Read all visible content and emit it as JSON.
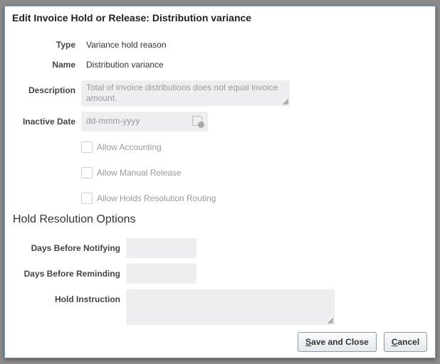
{
  "dialog": {
    "title": "Edit Invoice Hold or Release: Distribution variance"
  },
  "form": {
    "type_label": "Type",
    "type_value": "Variance hold reason",
    "name_label": "Name",
    "name_value": "Distribution variance",
    "description_label": "Description",
    "description_value": "Total of invoice distributions does not equal invoice amount.",
    "inactive_date_label": "Inactive Date",
    "inactive_date_placeholder": "dd-mmm-yyyy",
    "allow_accounting": "Allow Accounting",
    "allow_manual_release": "Allow Manual Release",
    "allow_routing": "Allow Holds Resolution Routing"
  },
  "resolution": {
    "heading": "Hold Resolution Options",
    "days_notifying_label": "Days Before Notifying",
    "days_reminding_label": "Days Before Reminding",
    "instruction_label": "Hold Instruction"
  },
  "buttons": {
    "save_first": "S",
    "save_rest": "ave and Close",
    "cancel_first": "C",
    "cancel_rest": "ancel"
  }
}
